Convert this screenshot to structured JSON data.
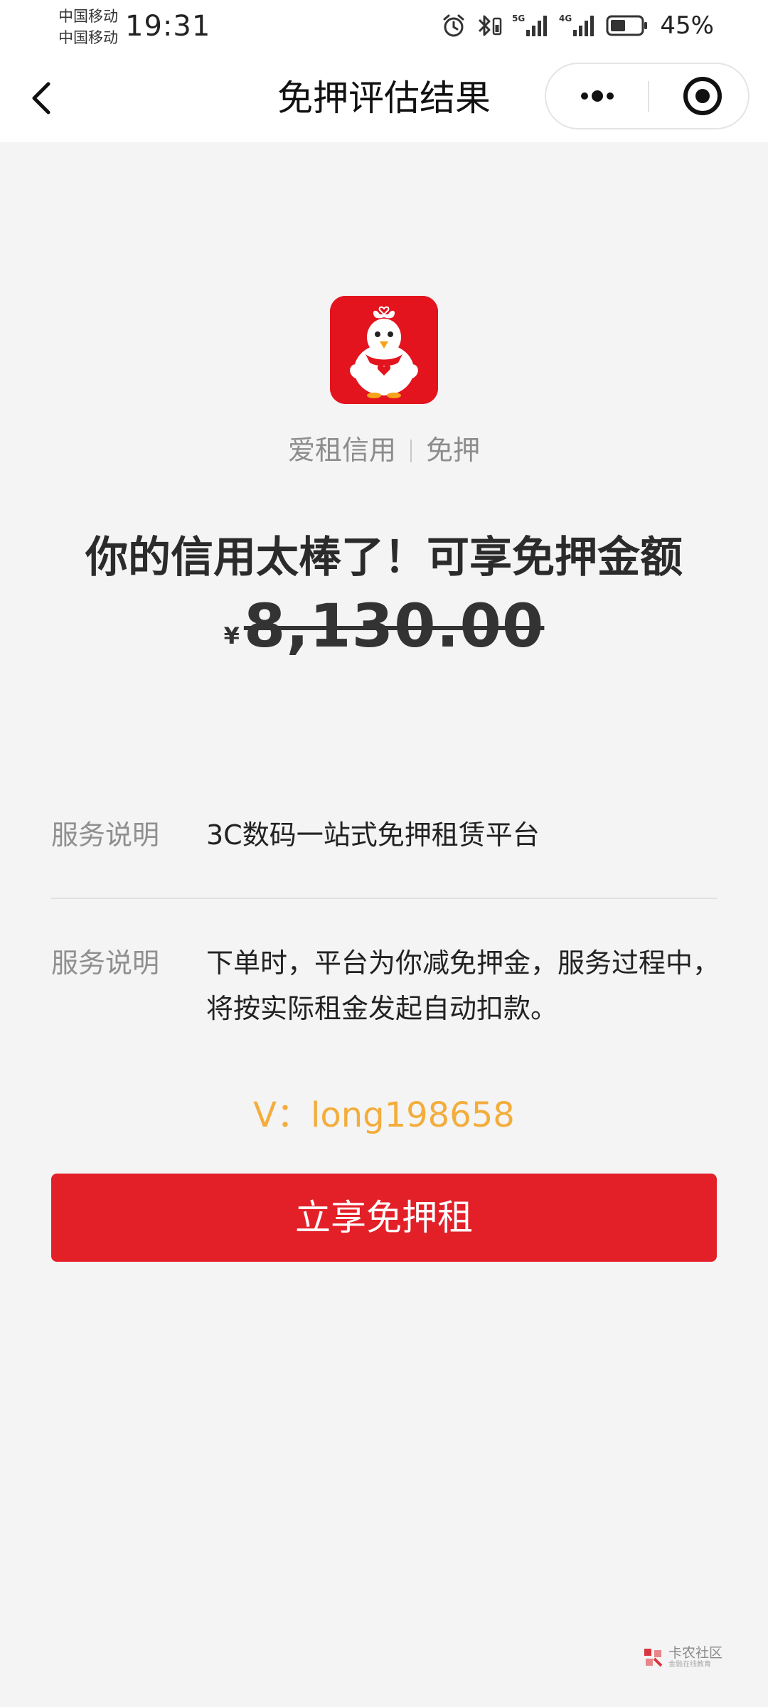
{
  "status_bar": {
    "carrier_1": "中国移动",
    "carrier_2": "中国移动",
    "time": "19:31",
    "net_1": "5G",
    "net_2": "4G",
    "battery": "45%",
    "icons": [
      "alarm-icon",
      "bluetooth-icon",
      "signal-5g-icon",
      "signal-4g-icon",
      "battery-icon"
    ]
  },
  "nav": {
    "title": "免押评估结果",
    "back_icon": "chevron-left-icon",
    "more_icon": "more-dots-icon",
    "close_icon": "target-close-icon"
  },
  "brand": {
    "name": "爱租信用",
    "tag": "免押",
    "logo_icon": "chicken-mascot-icon",
    "logo_color": "#e3141e"
  },
  "result": {
    "headline": "你的信用太棒了！可享免押金额",
    "currency": "¥",
    "amount": "8,130.00"
  },
  "info": [
    {
      "label": "服务说明",
      "value": "3C数码一站式免押租赁平台"
    },
    {
      "label": "服务说明",
      "value": "下单时，平台为你减免押金，服务过程中，将按实际租金发起自动扣款。"
    }
  ],
  "contact": "V：long198658",
  "cta": {
    "label": "立享免押租",
    "color": "#e32028"
  },
  "watermark": {
    "name": "卡农社区",
    "sub": "金融在线教育"
  }
}
